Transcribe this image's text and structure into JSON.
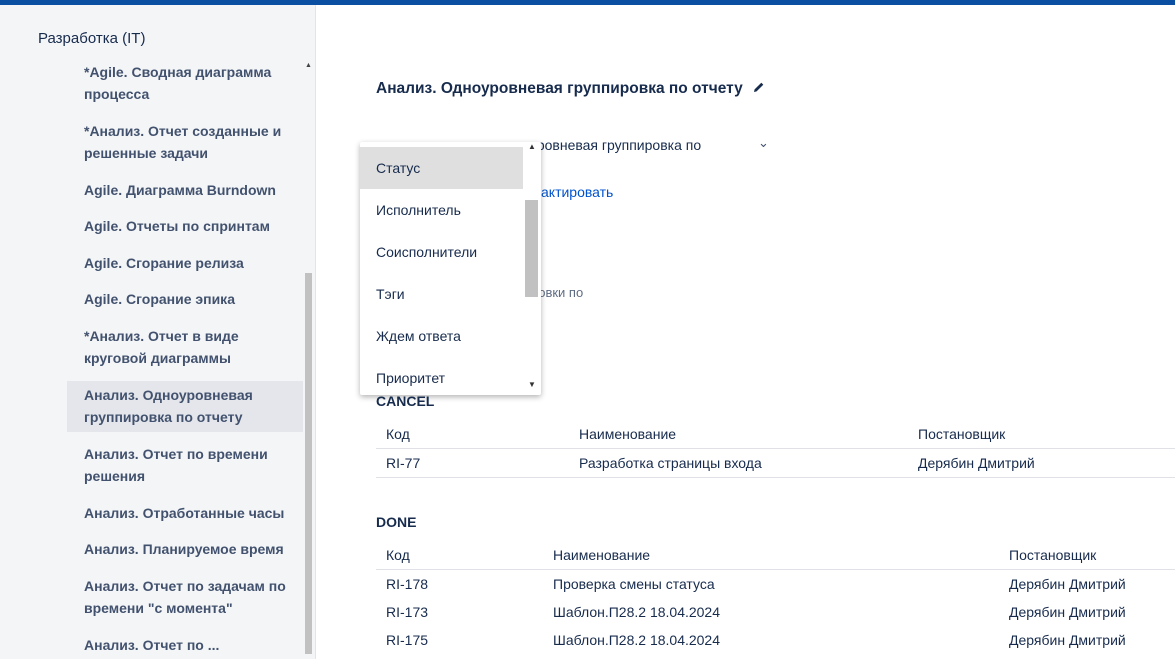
{
  "sidebar": {
    "title": "Разработка (IT)",
    "items": [
      {
        "label": "*Agile. Сводная диаграмма процесса"
      },
      {
        "label": "*Анализ. Отчет созданные и решенные задачи"
      },
      {
        "label": "Agile. Диаграмма Burndown"
      },
      {
        "label": "Agile. Отчеты по спринтам"
      },
      {
        "label": "Agile. Сгорание релиза"
      },
      {
        "label": "Agile. Сгорание эпика"
      },
      {
        "label": "*Анализ. Отчет в виде круговой диаграммы"
      },
      {
        "label": "Анализ. Одноуровневая группировка по отчету"
      },
      {
        "label": "Анализ. Отчет по времени решения"
      },
      {
        "label": "Анализ. Отработанные часы"
      },
      {
        "label": "Анализ. Планируемое время"
      },
      {
        "label": "Анализ. Отчет по задачам по времени \"с момента\""
      },
      {
        "label": "Анализ. Отчет по ..."
      }
    ],
    "active_index": 7
  },
  "main": {
    "title": "Анализ. Одноуровневая группировка по отчету",
    "field_partial": "уровневая группировка по",
    "edit_link_partial": "актировать",
    "group_by_partial": "ровки по"
  },
  "dropdown": {
    "options": [
      "Статус",
      "Исполнитель",
      "Соисполнители",
      "Тэги",
      "Ждем ответа",
      "Приоритет"
    ],
    "selected": "Статус"
  },
  "groups": [
    {
      "name": "CANCEL",
      "headers": [
        "Код",
        "Наименование",
        "Постановщик"
      ],
      "rows": [
        [
          "RI-77",
          "Разработка страницы входа",
          "Дерябин Дмитрий"
        ]
      ]
    },
    {
      "name": "DONE",
      "headers": [
        "Код",
        "Наименование",
        "Постановщик"
      ],
      "rows": [
        [
          "RI-178",
          "Проверка смены статуса",
          "Дерябин Дмитрий"
        ],
        [
          "RI-173",
          "Шаблон.П28.2 18.04.2024",
          "Дерябин Дмитрий"
        ],
        [
          "RI-175",
          "Шаблон.П28.2 18.04.2024",
          "Дерябин Дмитрий"
        ]
      ]
    }
  ]
}
